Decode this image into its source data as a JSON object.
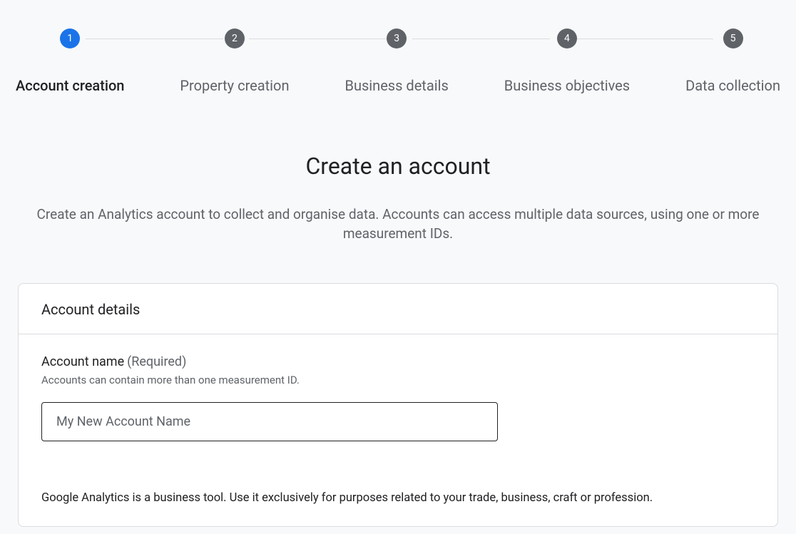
{
  "stepper": {
    "steps": [
      {
        "num": "1",
        "label": "Account creation",
        "active": true
      },
      {
        "num": "2",
        "label": "Property creation",
        "active": false
      },
      {
        "num": "3",
        "label": "Business details",
        "active": false
      },
      {
        "num": "4",
        "label": "Business objectives",
        "active": false
      },
      {
        "num": "5",
        "label": "Data collection",
        "active": false
      }
    ]
  },
  "page": {
    "title": "Create an account",
    "description": "Create an Analytics account to collect and organise data. Accounts can access multiple data sources, using one or more measurement IDs."
  },
  "card": {
    "header": "Account details",
    "field_label": "Account name",
    "field_required": "(Required)",
    "field_help": "Accounts can contain more than one measurement ID.",
    "input_placeholder": "My New Account Name",
    "disclaimer": "Google Analytics is a business tool. Use it exclusively for purposes related to your trade, business, craft or profession."
  }
}
